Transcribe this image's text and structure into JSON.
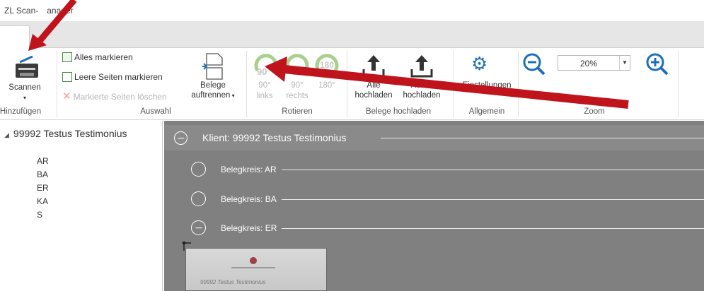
{
  "app": {
    "title": "RZL Scan-Manager",
    "title_shown": "ZL Scan-",
    "title_shown_end": "anager"
  },
  "ribbon": {
    "hinzufuegen": {
      "scan_button": "Scannen",
      "group_label": "Hinzufügen",
      "group_label_shown": "Hinzufügen"
    },
    "auswahl": {
      "mark_all": "Alles markieren",
      "mark_empty": "Leere Seiten markieren",
      "delete_marked": "Markierte Seiten löschen",
      "split_line1": "Belege",
      "split_line2": "auftrennen",
      "group_label": "Auswahl"
    },
    "rotieren": {
      "left_deg": "90°",
      "left_label": "links",
      "right_deg": "90°",
      "right_label": "rechts",
      "r180": "180°",
      "icon_left_text": "90",
      "icon_right_text": "90",
      "icon_180_text": "180",
      "group_label": "Rotieren"
    },
    "hochladen": {
      "all_line1": "Alle",
      "all_line2": "hochladen",
      "sel_line1": "Ausw.",
      "sel_line2": "hochladen",
      "group_label": "Belege hochladen"
    },
    "allgemein": {
      "settings": "Einstellungen",
      "group_label": "Allgemein"
    },
    "zoom": {
      "value": "20%",
      "group_label": "Zoom"
    }
  },
  "tree": {
    "root": "99992 Testus Testimonius",
    "children": [
      "AR",
      "BA",
      "ER",
      "KA",
      "S"
    ]
  },
  "content": {
    "client_header": "Klient: 99992 Testus Testimonius",
    "groups": [
      {
        "label": "Belegkreis: AR",
        "expanded": false
      },
      {
        "label": "Belegkreis: BA",
        "expanded": false
      },
      {
        "label": "Belegkreis: ER",
        "expanded": true
      }
    ],
    "thumbnail_text": "99992 Testus Testimonius"
  },
  "colors": {
    "annotation_arrow": "#c0141c",
    "content_bg": "#808080",
    "zoom_icon": "#1f6fb8",
    "rotate_icon_disabled": "#a8d08d"
  }
}
